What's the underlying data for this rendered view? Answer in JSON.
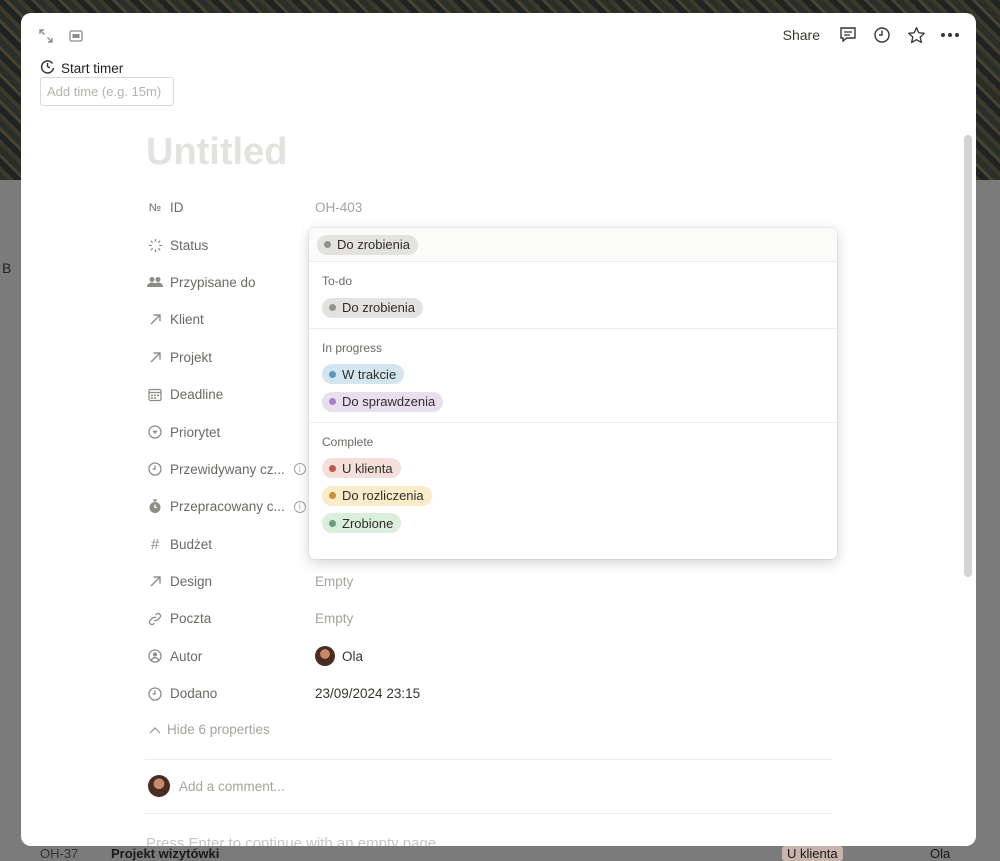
{
  "background": {
    "row_id": "OH-37",
    "row_title": "Projekt wizytówki",
    "row_status": "U klienta",
    "row_person": "Ola",
    "left_char": "B"
  },
  "topbar": {
    "expand_icon": "expand-icon",
    "peek_icon": "peek-mode-icon",
    "share_label": "Share",
    "icons": [
      "comment-icon",
      "history-icon",
      "star-icon",
      "more-icon"
    ]
  },
  "timer": {
    "label": "Start timer",
    "input_placeholder": "Add time (e.g. 15m)"
  },
  "page": {
    "title": "Untitled"
  },
  "properties": [
    {
      "name": "ID",
      "icon": "number-icon",
      "value": "OH-403",
      "muted": true
    },
    {
      "name": "Status",
      "icon": "status-icon",
      "value": ""
    },
    {
      "name": "Przypisane do",
      "icon": "people-icon",
      "value": ""
    },
    {
      "name": "Klient",
      "icon": "relation-arrow-icon",
      "value": ""
    },
    {
      "name": "Projekt",
      "icon": "relation-arrow-icon",
      "value": ""
    },
    {
      "name": "Deadline",
      "icon": "calendar-icon",
      "value": ""
    },
    {
      "name": "Priorytet",
      "icon": "select-icon",
      "value": ""
    },
    {
      "name": "Przewidywany cz...",
      "icon": "clock-icon",
      "value": "",
      "info": true
    },
    {
      "name": "Przepracowany c...",
      "icon": "timer-icon",
      "value": "",
      "info": true
    },
    {
      "name": "Budżet",
      "icon": "hash-icon",
      "value": ""
    },
    {
      "name": "Design",
      "icon": "relation-arrow-icon",
      "value": "Empty",
      "muted": true
    },
    {
      "name": "Poczta",
      "icon": "link-icon",
      "value": "Empty",
      "muted": true
    },
    {
      "name": "Autor",
      "icon": "person-icon",
      "value": "Ola",
      "avatar": true
    },
    {
      "name": "Dodano",
      "icon": "clock-icon",
      "value": "23/09/2024 23:15"
    }
  ],
  "hide_props_label": "Hide 6 properties",
  "comment_placeholder": "Add a comment...",
  "press_enter_hint": "Press Enter to continue with an empty page",
  "status_dropdown": {
    "current": {
      "label": "Do zrobienia",
      "bg": "#e3e2e0",
      "dot": "#91918e"
    },
    "groups": [
      {
        "label": "To-do",
        "options": [
          {
            "label": "Do zrobienia",
            "bg": "#e3e2e0",
            "dot": "#91918e"
          }
        ]
      },
      {
        "label": "In progress",
        "options": [
          {
            "label": "W trakcie",
            "bg": "#d3e5ef",
            "dot": "#5b97bd"
          },
          {
            "label": "Do sprawdzenia",
            "bg": "#e8deee",
            "dot": "#a782c3"
          }
        ]
      },
      {
        "label": "Complete",
        "options": [
          {
            "label": "U klienta",
            "bg": "#f4dfdb",
            "dot": "#c4554d"
          },
          {
            "label": "Do rozliczenia",
            "bg": "#fbecc9",
            "dot": "#cb912f"
          },
          {
            "label": "Zrobione",
            "bg": "#dbeddb",
            "dot": "#6c9b7d"
          }
        ]
      }
    ]
  }
}
